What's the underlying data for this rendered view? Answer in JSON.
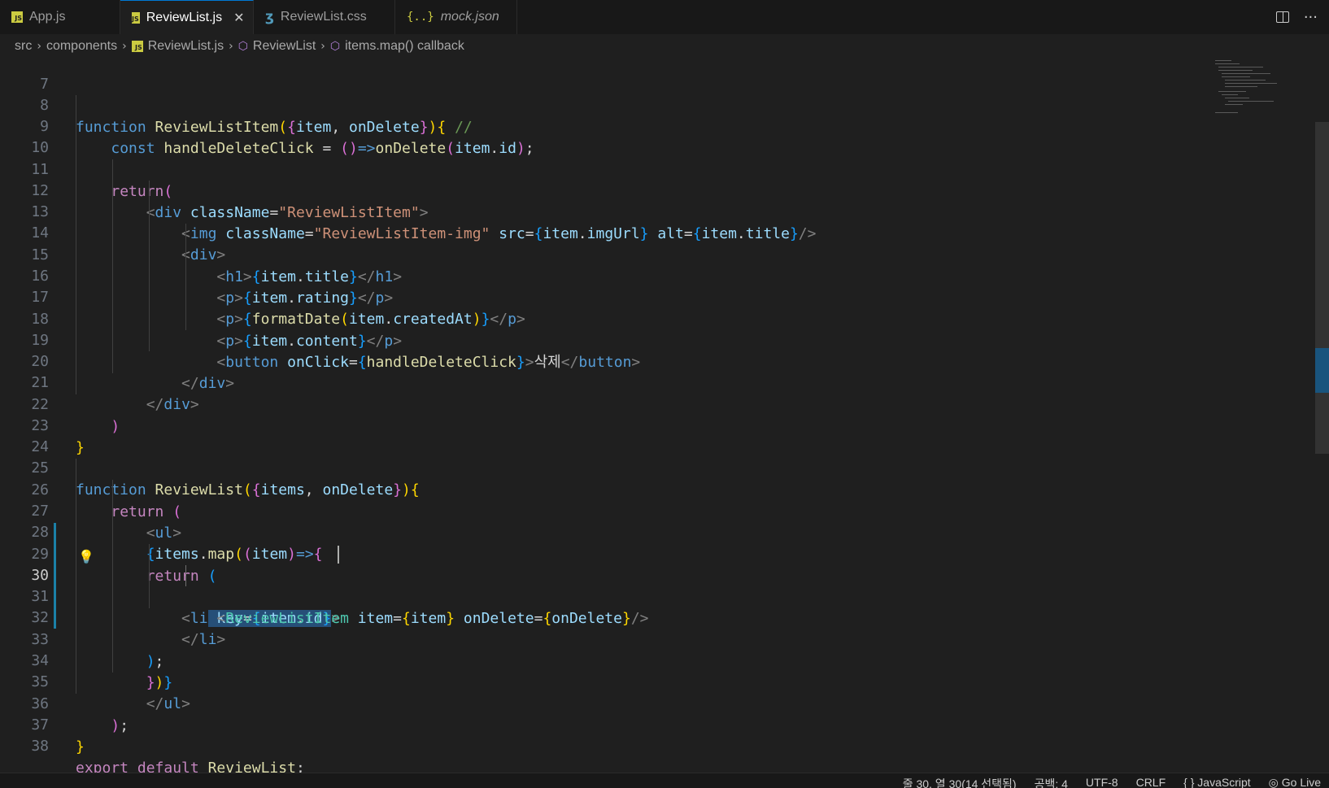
{
  "tabs": [
    {
      "label": "App.js",
      "icon": "js-file-icon"
    },
    {
      "label": "ReviewList.js",
      "icon": "js-file-icon",
      "active": true
    },
    {
      "label": "ReviewList.css",
      "icon": "css-file-icon"
    },
    {
      "label": "mock.json",
      "icon": "json-file-icon"
    }
  ],
  "breadcrumb": {
    "src": "src",
    "components": "components",
    "file": "ReviewList.js",
    "fn": "ReviewList",
    "cb": "items.map() callback"
  },
  "editor": {
    "line_numbers": [
      "7",
      "8",
      "9",
      "10",
      "11",
      "12",
      "13",
      "14",
      "15",
      "16",
      "17",
      "18",
      "19",
      "20",
      "21",
      "22",
      "23",
      "24",
      "25",
      "26",
      "27",
      "28",
      "29",
      "30",
      "31",
      "32",
      "33",
      "34",
      "35",
      "36",
      "37",
      "38"
    ],
    "current_line": "30"
  },
  "statusbar": {
    "position": "줄 30, 열 30(14 선택됨)",
    "indent": "공백: 4",
    "encoding": "UTF-8",
    "eol": "CRLF",
    "language": "JavaScript",
    "live": "Go Live"
  },
  "colors": {
    "accent": "#0078d4",
    "background": "#1f1f1f",
    "selection": "#264f78"
  }
}
